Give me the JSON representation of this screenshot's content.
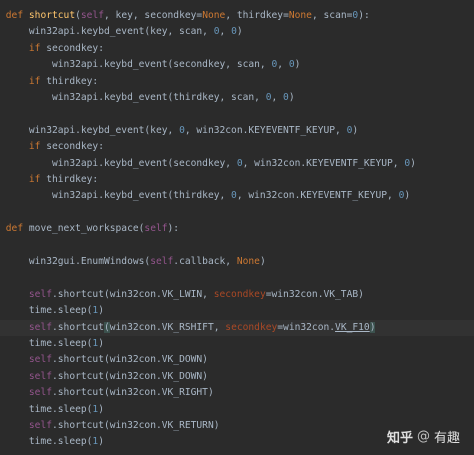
{
  "editor": {
    "lines": [
      {
        "tokens": [
          [
            "keyword",
            "def "
          ],
          [
            "funcname",
            "shortcut"
          ],
          [
            "plain",
            "("
          ],
          [
            "self",
            "self"
          ],
          [
            "plain",
            ", key, secondkey="
          ],
          [
            "const",
            "None"
          ],
          [
            "plain",
            ", thirdkey="
          ],
          [
            "const",
            "None"
          ],
          [
            "plain",
            ", scan="
          ],
          [
            "number",
            "0"
          ],
          [
            "plain",
            "):"
          ]
        ]
      },
      {
        "tokens": [
          [
            "plain",
            "    win32api.keybd_event(key, scan, "
          ],
          [
            "number",
            "0"
          ],
          [
            "plain",
            ", "
          ],
          [
            "number",
            "0"
          ],
          [
            "plain",
            ")"
          ]
        ]
      },
      {
        "tokens": [
          [
            "plain",
            "    "
          ],
          [
            "keyword",
            "if "
          ],
          [
            "plain",
            "secondkey:"
          ]
        ]
      },
      {
        "tokens": [
          [
            "plain",
            "        win32api.keybd_event(secondkey, scan, "
          ],
          [
            "number",
            "0"
          ],
          [
            "plain",
            ", "
          ],
          [
            "number",
            "0"
          ],
          [
            "plain",
            ")"
          ]
        ]
      },
      {
        "tokens": [
          [
            "plain",
            "    "
          ],
          [
            "keyword",
            "if "
          ],
          [
            "plain",
            "thirdkey:"
          ]
        ]
      },
      {
        "tokens": [
          [
            "plain",
            "        win32api.keybd_event(thirdkey, scan, "
          ],
          [
            "number",
            "0"
          ],
          [
            "plain",
            ", "
          ],
          [
            "number",
            "0"
          ],
          [
            "plain",
            ")"
          ]
        ]
      },
      {
        "tokens": []
      },
      {
        "tokens": [
          [
            "plain",
            "    win32api.keybd_event(key, "
          ],
          [
            "number",
            "0"
          ],
          [
            "plain",
            ", win32con.KEYEVENTF_KEYUP, "
          ],
          [
            "number",
            "0"
          ],
          [
            "plain",
            ")"
          ]
        ]
      },
      {
        "tokens": [
          [
            "plain",
            "    "
          ],
          [
            "keyword",
            "if "
          ],
          [
            "plain",
            "secondkey:"
          ]
        ]
      },
      {
        "tokens": [
          [
            "plain",
            "        win32api.keybd_event(secondkey, "
          ],
          [
            "number",
            "0"
          ],
          [
            "plain",
            ", win32con.KEYEVENTF_KEYUP, "
          ],
          [
            "number",
            "0"
          ],
          [
            "plain",
            ")"
          ]
        ]
      },
      {
        "tokens": [
          [
            "plain",
            "    "
          ],
          [
            "keyword",
            "if "
          ],
          [
            "plain",
            "thirdkey:"
          ]
        ]
      },
      {
        "tokens": [
          [
            "plain",
            "        win32api.keybd_event(thirdkey, "
          ],
          [
            "number",
            "0"
          ],
          [
            "plain",
            ", win32con.KEYEVENTF_KEYUP, "
          ],
          [
            "number",
            "0"
          ],
          [
            "plain",
            ")"
          ]
        ]
      },
      {
        "tokens": []
      },
      {
        "tokens": [
          [
            "keyword",
            "def "
          ],
          [
            "plain",
            "move_next_workspace("
          ],
          [
            "self",
            "self"
          ],
          [
            "plain",
            "):"
          ]
        ]
      },
      {
        "tokens": []
      },
      {
        "tokens": [
          [
            "plain",
            "    win32gui.EnumWindows("
          ],
          [
            "self",
            "self"
          ],
          [
            "plain",
            ".callback, "
          ],
          [
            "const",
            "None"
          ],
          [
            "plain",
            ")"
          ]
        ]
      },
      {
        "tokens": []
      },
      {
        "tokens": [
          [
            "plain",
            "    "
          ],
          [
            "self",
            "self"
          ],
          [
            "plain",
            ".shortcut(win32con.VK_LWIN, "
          ],
          [
            "kwarg",
            "secondkey"
          ],
          [
            "plain",
            "=win32con.VK_TAB)"
          ]
        ]
      },
      {
        "tokens": [
          [
            "plain",
            "    time.sleep("
          ],
          [
            "number",
            "1"
          ],
          [
            "plain",
            ")"
          ]
        ]
      },
      {
        "current": true,
        "tokens": [
          [
            "plain",
            "    "
          ],
          [
            "self",
            "self"
          ],
          [
            "plain",
            ".shortcut"
          ],
          [
            "bracket",
            "("
          ],
          [
            "plain",
            "win32con.VK_RSHIFT, "
          ],
          [
            "kwarg",
            "secondkey"
          ],
          [
            "plain",
            "=win32con."
          ],
          [
            "underline",
            "VK_F10"
          ],
          [
            "bracket",
            ")"
          ]
        ]
      },
      {
        "tokens": [
          [
            "plain",
            "    time.sleep("
          ],
          [
            "number",
            "1"
          ],
          [
            "plain",
            ")"
          ]
        ]
      },
      {
        "tokens": [
          [
            "plain",
            "    "
          ],
          [
            "self",
            "self"
          ],
          [
            "plain",
            ".shortcut(win32con.VK_DOWN)"
          ]
        ]
      },
      {
        "tokens": [
          [
            "plain",
            "    "
          ],
          [
            "self",
            "self"
          ],
          [
            "plain",
            ".shortcut(win32con.VK_DOWN)"
          ]
        ]
      },
      {
        "tokens": [
          [
            "plain",
            "    "
          ],
          [
            "self",
            "self"
          ],
          [
            "plain",
            ".shortcut(win32con.VK_RIGHT)"
          ]
        ]
      },
      {
        "tokens": [
          [
            "plain",
            "    time.sleep("
          ],
          [
            "number",
            "1"
          ],
          [
            "plain",
            ")"
          ]
        ]
      },
      {
        "tokens": [
          [
            "plain",
            "    "
          ],
          [
            "self",
            "self"
          ],
          [
            "plain",
            ".shortcut(win32con.VK_RETURN)"
          ]
        ]
      },
      {
        "tokens": [
          [
            "plain",
            "    time.sleep("
          ],
          [
            "number",
            "1"
          ],
          [
            "plain",
            ")"
          ]
        ]
      }
    ]
  },
  "watermark": {
    "logo": "知乎",
    "at": "@",
    "name": "有趣"
  },
  "colors": {
    "background": "#2b2b2b",
    "current_line": "#323232",
    "plain": "#a9b7c6",
    "keyword": "#cc7832",
    "function_name": "#ffc66d",
    "self": "#94558d",
    "number": "#6897bb",
    "kwarg": "#aa4926",
    "bracket_match": "#3b514d"
  }
}
